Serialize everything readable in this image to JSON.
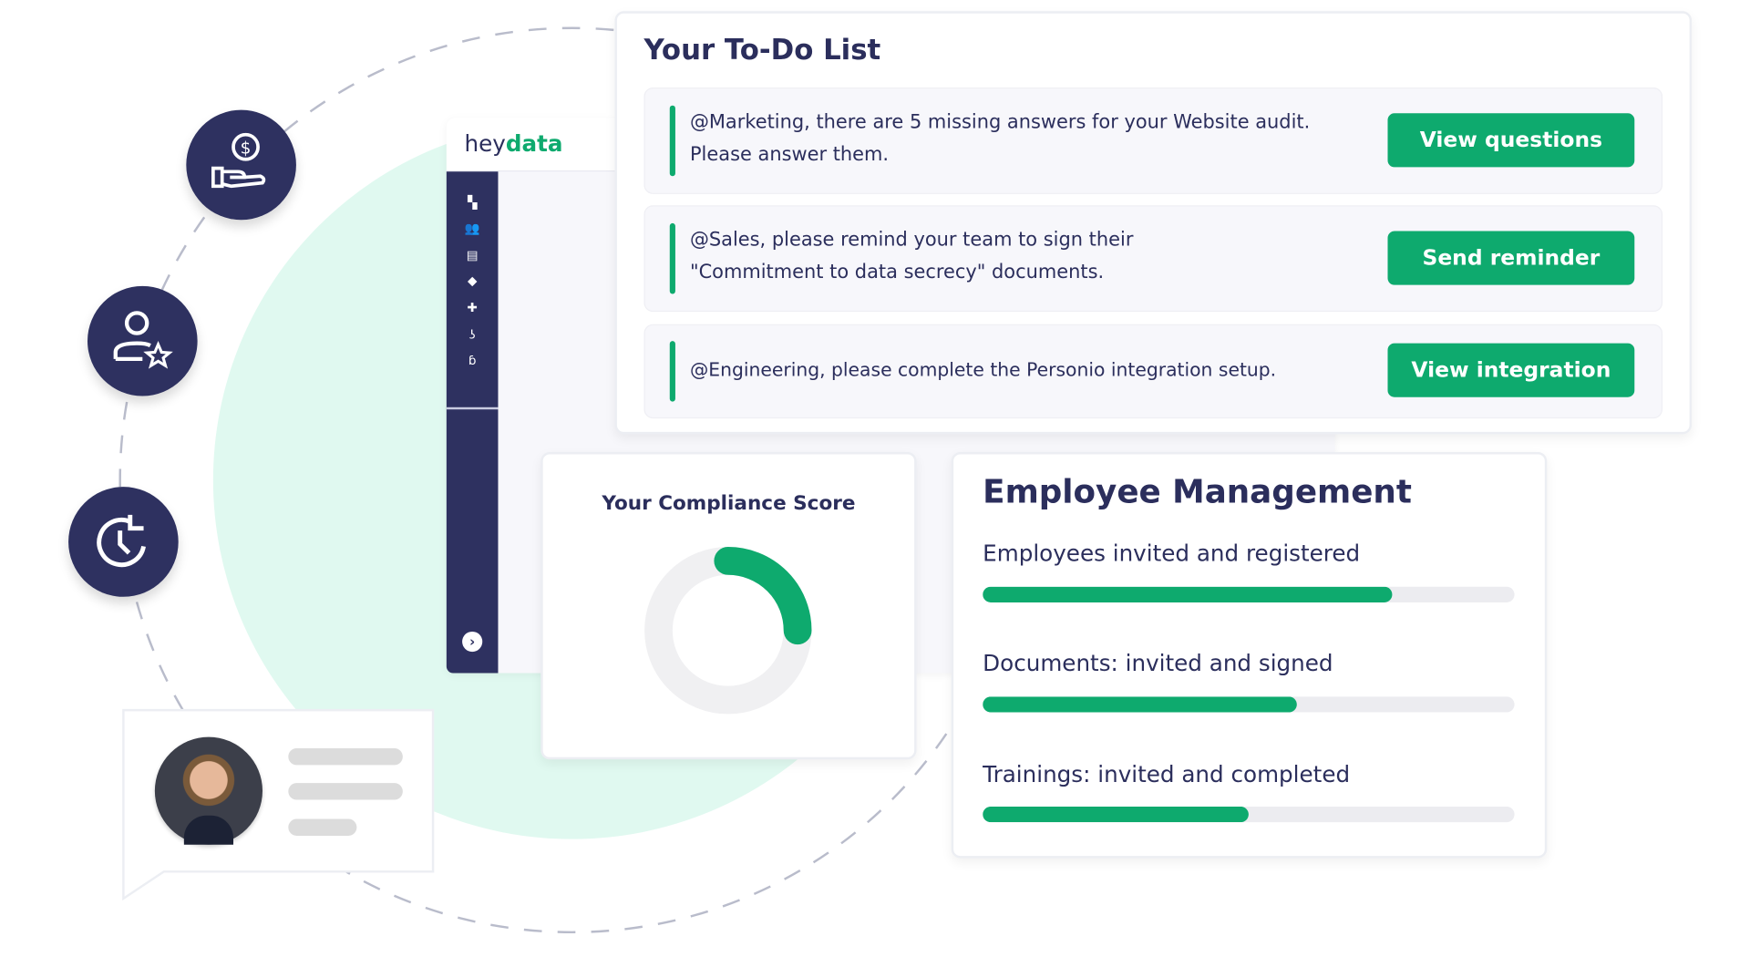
{
  "brand": {
    "logo_prefix": "hey",
    "logo_suffix": "data",
    "accent": "#0eaa6e",
    "navy": "#2e3160"
  },
  "feature_icons": [
    "money-hand-icon",
    "user-star-icon",
    "clock-refresh-icon"
  ],
  "sidebar": {
    "icons": [
      "dashboard-icon",
      "users-icon",
      "clipboard-icon",
      "graduation-cap-icon",
      "puzzle-icon",
      "hook-icon",
      "whistle-icon"
    ],
    "expand_icon": "chevron-right-icon"
  },
  "todo": {
    "title": "Your To-Do List",
    "items": [
      {
        "text": "@Marketing, there are 5 missing answers for your Website audit. Please answer them.",
        "button": "View questions"
      },
      {
        "text": "@Sales, please remind your team to sign their \"Commitment to data secrecy\" documents.",
        "button": "Send reminder"
      },
      {
        "text": "@Engineering, please complete the Personio integration setup.",
        "button": "View integration"
      }
    ]
  },
  "compliance": {
    "title": "Your Compliance Score",
    "score_fraction": 0.25
  },
  "employee": {
    "title": "Employee Management",
    "metrics": [
      {
        "label": "Employees invited and registered",
        "progress": 0.77
      },
      {
        "label": "Documents: invited and signed",
        "progress": 0.59
      },
      {
        "label": "Trainings: invited and completed",
        "progress": 0.5
      }
    ]
  }
}
